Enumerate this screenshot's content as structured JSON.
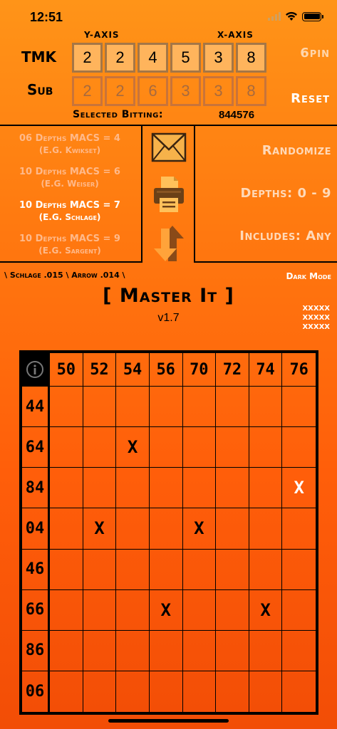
{
  "status": {
    "time": "12:51"
  },
  "axes": {
    "y_label": "Y-AXIS",
    "x_label": "X-AXIS"
  },
  "rows": {
    "tmk_label": "TMK",
    "sub_label": "Sub",
    "tmk": [
      "2",
      "2",
      "4",
      "5",
      "3",
      "8"
    ],
    "sub": [
      "2",
      "2",
      "6",
      "3",
      "3",
      "8"
    ]
  },
  "controls": {
    "pins": "6pin",
    "reset": "Reset"
  },
  "selected": {
    "label": "Selected Bitting:",
    "value": "844576"
  },
  "macs": [
    {
      "title": "06 Depths MACS = 4",
      "sub": "(E.G. Kwikset)",
      "active": false
    },
    {
      "title": "10 Depths MACS = 6",
      "sub": "(E.G. Weiser)",
      "active": false
    },
    {
      "title": "10 Depths MACS = 7",
      "sub": "(E.G. Schlage)",
      "active": true
    },
    {
      "title": "10 Depths MACS = 9",
      "sub": "(E.G. Sargent)",
      "active": false
    }
  ],
  "options": {
    "randomize": "Randomize",
    "depths": "Depths: 0 - 9",
    "includes": "Includes: Any"
  },
  "links": {
    "schlage_arrow": "\\ Schlage .015 \\ Arrow .014 \\",
    "dark_mode": "Dark Mode"
  },
  "app": {
    "title": "[ Master It ]",
    "version": "v1.7",
    "xxx": [
      "XXXXX",
      "XXXXX",
      "XXXXX"
    ]
  },
  "grid": {
    "cols": [
      "50",
      "52",
      "54",
      "56",
      "70",
      "72",
      "74",
      "76"
    ],
    "rows": [
      "44",
      "64",
      "84",
      "04",
      "46",
      "66",
      "86",
      "06"
    ],
    "marks": [
      {
        "row": 1,
        "col": 2,
        "text": "X",
        "color": "#000000"
      },
      {
        "row": 2,
        "col": 7,
        "text": "X",
        "color": "#ffffff"
      },
      {
        "row": 3,
        "col": 1,
        "text": "X",
        "color": "#000000"
      },
      {
        "row": 3,
        "col": 4,
        "text": "X",
        "color": "#000000"
      },
      {
        "row": 5,
        "col": 3,
        "text": "X",
        "color": "#000000"
      },
      {
        "row": 5,
        "col": 6,
        "text": "X",
        "color": "#000000"
      }
    ]
  }
}
